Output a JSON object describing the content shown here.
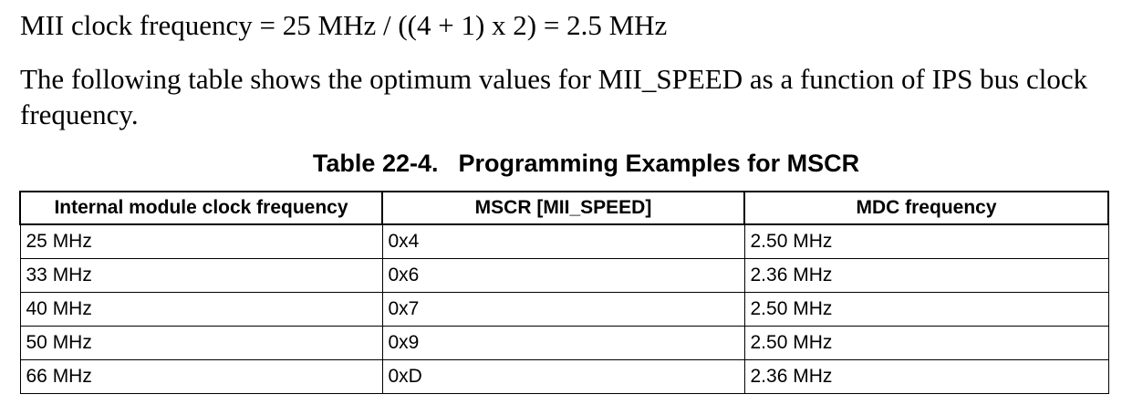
{
  "formula": "MII clock frequency = 25 MHz / ((4 + 1) x 2) = 2.5 MHz",
  "paragraph": "The following table shows the optimum values for MII_SPEED as a function of IPS bus clock frequency.",
  "table": {
    "caption_number": "Table 22-4.",
    "caption_title": "Programming Examples for MSCR",
    "headers": [
      "Internal module clock frequency",
      "MSCR [MII_SPEED]",
      "MDC frequency"
    ],
    "rows": [
      [
        "25 MHz",
        "0x4",
        "2.50 MHz"
      ],
      [
        "33 MHz",
        "0x6",
        "2.36 MHz"
      ],
      [
        "40 MHz",
        "0x7",
        "2.50 MHz"
      ],
      [
        "50 MHz",
        "0x9",
        "2.50 MHz"
      ],
      [
        "66 MHz",
        "0xD",
        "2.36 MHz"
      ]
    ]
  }
}
